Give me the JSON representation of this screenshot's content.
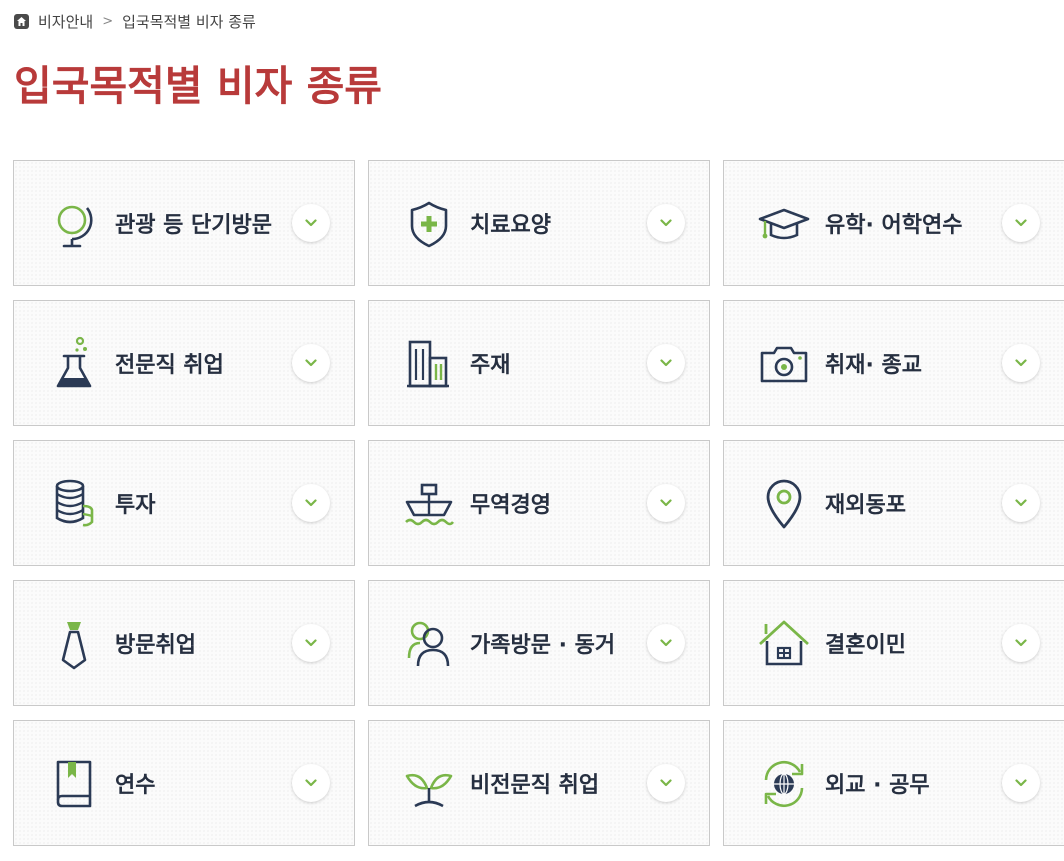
{
  "breadcrumb": {
    "items": [
      "비자안내",
      "입국목적별 비자 종류"
    ],
    "separator": ">"
  },
  "page_title": "입국목적별 비자 종류",
  "colors": {
    "title": "#b83a3a",
    "icon_navy": "#2b3a55",
    "icon_green": "#7ab648"
  },
  "cards": [
    {
      "label": "관광 등 단기방문",
      "icon": "globe-icon"
    },
    {
      "label": "치료요양",
      "icon": "shield-plus-icon"
    },
    {
      "label": "유학· 어학연수",
      "icon": "graduation-cap-icon"
    },
    {
      "label": "전문직 취업",
      "icon": "flask-icon"
    },
    {
      "label": "주재",
      "icon": "building-icon"
    },
    {
      "label": "취재· 종교",
      "icon": "camera-icon"
    },
    {
      "label": "투자",
      "icon": "coin-stack-icon"
    },
    {
      "label": "무역경영",
      "icon": "ship-icon"
    },
    {
      "label": "재외동포",
      "icon": "map-pin-icon"
    },
    {
      "label": "방문취업",
      "icon": "necktie-icon"
    },
    {
      "label": "가족방문 · 동거",
      "icon": "family-icon"
    },
    {
      "label": "결혼이민",
      "icon": "house-icon"
    },
    {
      "label": "연수",
      "icon": "book-icon"
    },
    {
      "label": "비전문직 취업",
      "icon": "sprout-icon"
    },
    {
      "label": "외교 · 공무",
      "icon": "globe-arrows-icon"
    }
  ]
}
